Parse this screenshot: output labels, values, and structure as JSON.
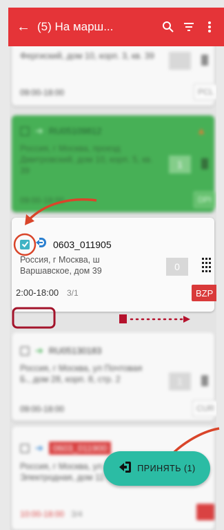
{
  "appbar": {
    "title": "(5) На марш...",
    "icons": [
      "back-arrow-icon",
      "search-icon",
      "filter-icon",
      "more-vert-icon"
    ]
  },
  "cards": [
    {
      "address": "Фергиский, дом 10, корп. 3, кв. 39",
      "time": "09:00-18:00",
      "tag": "PCL"
    },
    {
      "code": "RU05109812",
      "address": "Россия, г Москва, проезд Дмитровский, дом 10, корп. 5, кв. 39",
      "qty": "1",
      "time": "09:00-18:00",
      "tag": "DPI"
    },
    {
      "code": "0603_011905",
      "address": "Россия, г Москва, ш Варшавское, дом 39",
      "qty": "0",
      "time": "2:00-18:00",
      "count": "3/1",
      "tag": "BZP",
      "checked": true
    },
    {
      "code": "RU05130183",
      "address": "Россия, г Москва, ул Почтовая Б., дом 28, корп. 8, стр. 2",
      "qty": "1",
      "time": "09:00-18:00",
      "tag": "CUR"
    },
    {
      "code": "0603_011900",
      "address": "Россия, г Москва, ул Электродная, дом 11",
      "time": "10:00-18:00",
      "count": "3/4"
    }
  ],
  "fab": {
    "label": "ПРИНЯТЬ (1)"
  },
  "colors": {
    "appbar": "#e53438",
    "green_card": "#3fae4f",
    "annotation": "#a3142b",
    "arrow": "#d9452a",
    "fab": "#2bbca4",
    "tag_red": "#d93a3a"
  }
}
